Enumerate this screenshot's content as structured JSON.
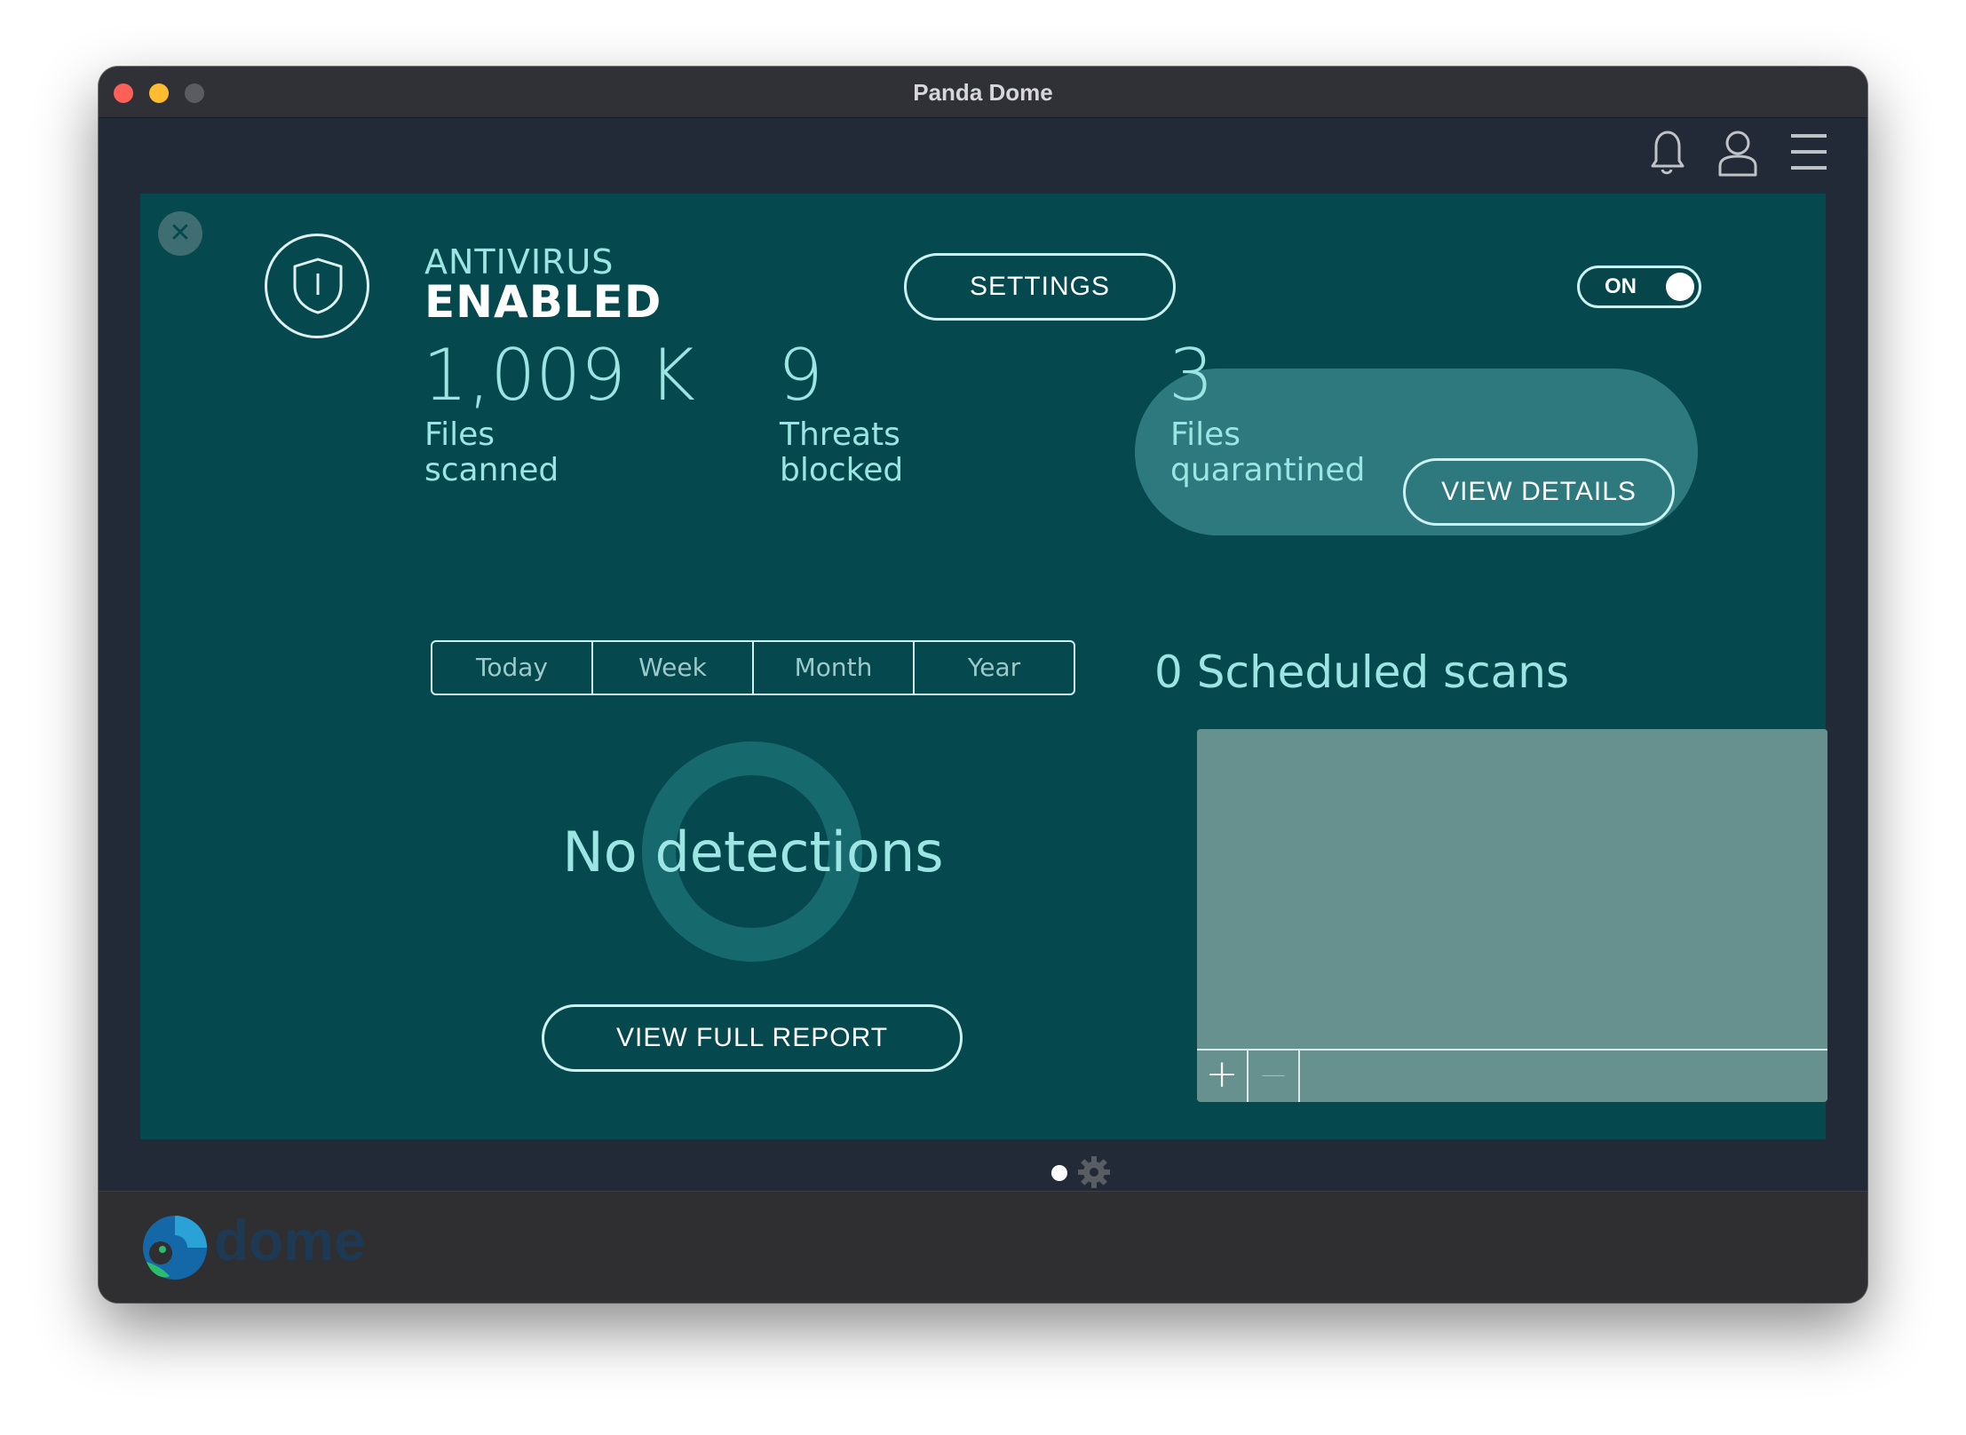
{
  "window": {
    "title": "Panda Dome"
  },
  "topbar": {
    "icons": [
      "bell-icon",
      "user-icon",
      "menu-icon"
    ]
  },
  "antivirus": {
    "title": "ANTIVIRUS",
    "status": "ENABLED",
    "settings_label": "SETTINGS",
    "toggle_label": "ON"
  },
  "stats": {
    "files_scanned": {
      "value": "1,009 K",
      "label_line1": "Files",
      "label_line2": "scanned"
    },
    "threats_blocked": {
      "value": "9",
      "label_line1": "Threats",
      "label_line2": "blocked"
    },
    "files_quarantined": {
      "value": "3",
      "label_line1": "Files",
      "label_line2": "quarantined",
      "button": "VIEW DETAILS"
    }
  },
  "period_tabs": [
    "Today",
    "Week",
    "Month",
    "Year"
  ],
  "detections": {
    "message": "No detections",
    "report_button": "VIEW FULL REPORT"
  },
  "scheduled": {
    "count": "0",
    "label": "Scheduled scans",
    "add_symbol": "+",
    "remove_symbol": "—"
  },
  "footer": {
    "brand": "dome"
  },
  "colors": {
    "panel": "#05484d",
    "accent": "#9de4e4",
    "quarantine_bg": "#2e797e"
  }
}
